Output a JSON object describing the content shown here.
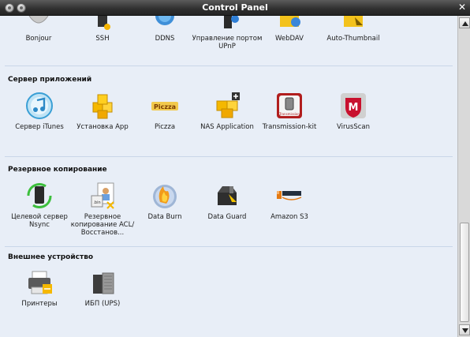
{
  "window": {
    "title": "Control Panel"
  },
  "top_row": [
    {
      "label": "Bonjour",
      "icon": "bonjour-icon"
    },
    {
      "label": "SSH",
      "icon": "ssh-icon"
    },
    {
      "label": "DDNS",
      "icon": "ddns-icon"
    },
    {
      "label": "Управление портом UPnP",
      "icon": "upnp-icon"
    },
    {
      "label": "WebDAV",
      "icon": "webdav-icon"
    },
    {
      "label": "Auto-Thumbnail",
      "icon": "auto-thumbnail-icon"
    }
  ],
  "sections": [
    {
      "title": "Сервер приложений",
      "items": [
        {
          "label": "Сервер iTunes",
          "icon": "itunes-icon"
        },
        {
          "label": "Установка App",
          "icon": "app-install-icon"
        },
        {
          "label": "Piczza",
          "icon": "piczza-icon"
        },
        {
          "label": "NAS Application",
          "icon": "nas-application-icon"
        },
        {
          "label": "Transmission-kit",
          "icon": "transmission-icon"
        },
        {
          "label": "VirusScan",
          "icon": "virusscan-icon"
        }
      ]
    },
    {
      "title": "Резервное копирование",
      "items": [
        {
          "label": "Целевой сервер Nsync",
          "icon": "nsync-icon"
        },
        {
          "label": "Резервное копирование ACL/Восстанов...",
          "icon": "acl-backup-icon"
        },
        {
          "label": "Data Burn",
          "icon": "data-burn-icon"
        },
        {
          "label": "Data Guard",
          "icon": "data-guard-icon"
        },
        {
          "label": "Amazon S3",
          "icon": "amazon-s3-icon"
        }
      ]
    },
    {
      "title": "Внешнее устройство",
      "items": [
        {
          "label": "Принтеры",
          "icon": "printer-icon"
        },
        {
          "label": "ИБП (UPS)",
          "icon": "ups-icon"
        }
      ]
    }
  ],
  "colors": {
    "titlebar": "#2f2f2f",
    "panel_bg": "#e8eef7",
    "section_line": "#c9d6e8"
  }
}
